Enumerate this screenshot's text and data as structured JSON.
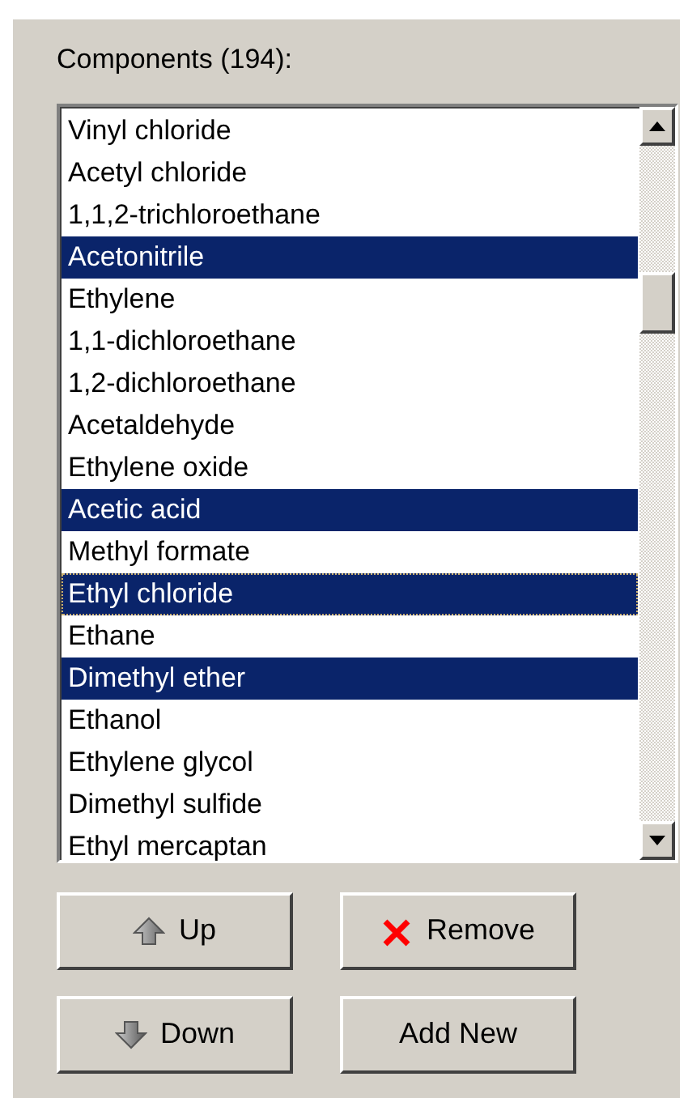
{
  "label": "Components (194):",
  "items": [
    {
      "name": "Vinyl chloride",
      "selected": false,
      "focused": false
    },
    {
      "name": "Acetyl chloride",
      "selected": false,
      "focused": false
    },
    {
      "name": "1,1,2-trichloroethane",
      "selected": false,
      "focused": false
    },
    {
      "name": "Acetonitrile",
      "selected": true,
      "focused": false
    },
    {
      "name": "Ethylene",
      "selected": false,
      "focused": false
    },
    {
      "name": "1,1-dichloroethane",
      "selected": false,
      "focused": false
    },
    {
      "name": "1,2-dichloroethane",
      "selected": false,
      "focused": false
    },
    {
      "name": "Acetaldehyde",
      "selected": false,
      "focused": false
    },
    {
      "name": "Ethylene oxide",
      "selected": false,
      "focused": false
    },
    {
      "name": "Acetic acid",
      "selected": true,
      "focused": false
    },
    {
      "name": "Methyl formate",
      "selected": false,
      "focused": false
    },
    {
      "name": "Ethyl chloride",
      "selected": true,
      "focused": true
    },
    {
      "name": "Ethane",
      "selected": false,
      "focused": false
    },
    {
      "name": "Dimethyl ether",
      "selected": true,
      "focused": false
    },
    {
      "name": "Ethanol",
      "selected": false,
      "focused": false
    },
    {
      "name": "Ethylene glycol",
      "selected": false,
      "focused": false
    },
    {
      "name": "Dimethyl sulfide",
      "selected": false,
      "focused": false
    },
    {
      "name": "Ethyl mercaptan",
      "selected": false,
      "focused": false
    }
  ],
  "buttons": [
    {
      "label": "Up",
      "kind": "up"
    },
    {
      "label": "Remove",
      "kind": "remove"
    },
    {
      "label": "Down",
      "kind": "down"
    },
    {
      "label": "Add New",
      "kind": "plain"
    }
  ]
}
